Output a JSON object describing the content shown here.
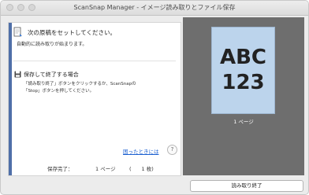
{
  "window": {
    "title": "ScanSnap Manager - イメージ読み取りとファイル保存"
  },
  "instructions": {
    "heading": "次の原稿をセットしてください。",
    "subtext": "自動的に読み取りが始まります。"
  },
  "save_section": {
    "heading": "保存して終了する場合",
    "desc_line1": "「読み取り終了」ボタンをクリックするか、ScanSnapの",
    "desc_line2": "「Stop」ボタンを押してください。"
  },
  "help": {
    "link_text": "困ったときには",
    "icon_text": "?"
  },
  "status": {
    "label": "保存完了：",
    "pages": "1 ページ",
    "sheets": "(　　1 枚)"
  },
  "preview": {
    "line1": "ABC",
    "line2": "123",
    "page_label": "1 ページ"
  },
  "buttons": {
    "finish": "読み取り終了"
  },
  "colors": {
    "accent": "#4f6fa8",
    "preview_bg": "#6e6e6e",
    "page_bg": "#bcd4ec",
    "link": "#1a5fd0"
  },
  "icons": {
    "document": "document-icon",
    "save": "save-icon",
    "help": "help-icon"
  }
}
